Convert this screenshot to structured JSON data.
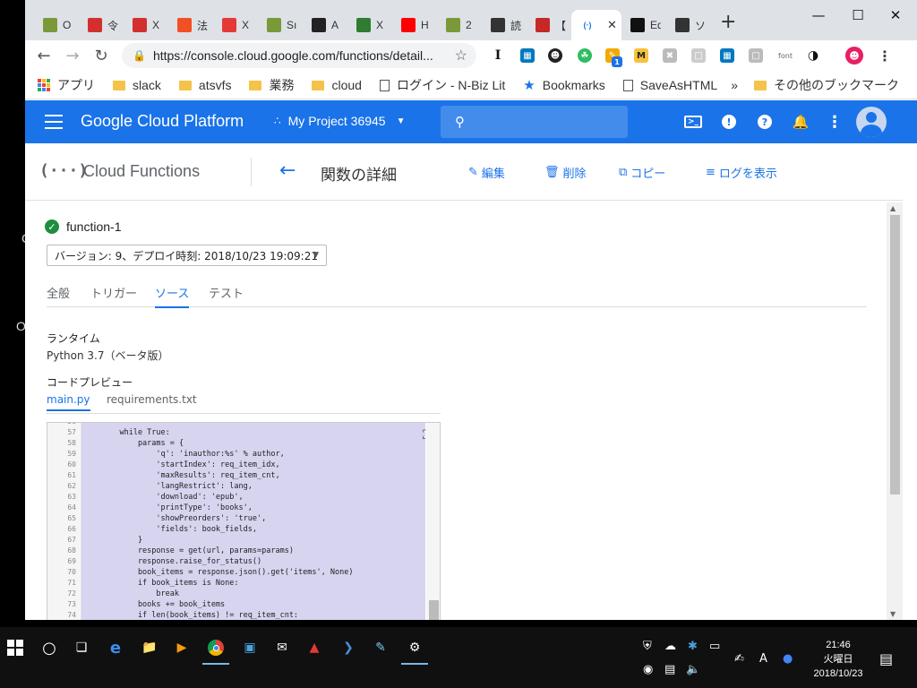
{
  "browser": {
    "tabs": [
      {
        "icon": "window-icon",
        "title": "O",
        "color": "#7a9a3a"
      },
      {
        "icon": "t-logo-icon",
        "title": "令",
        "color": "#d32f2f"
      },
      {
        "icon": "t-logo-icon",
        "title": "X",
        "color": "#d32f2f"
      },
      {
        "icon": "microsoft-icon",
        "title": "法",
        "color": "#f25022"
      },
      {
        "icon": "circle-logo-icon",
        "title": "X",
        "color": "#e53935"
      },
      {
        "icon": "window-icon",
        "title": "Sı",
        "color": "#7a9a3a"
      },
      {
        "icon": "amazon-icon",
        "title": "A",
        "color": "#222222"
      },
      {
        "icon": "leaf-icon",
        "title": "X",
        "color": "#2e7d32"
      },
      {
        "icon": "youtube-icon",
        "title": "H",
        "color": "#ff0000"
      },
      {
        "icon": "window-icon",
        "title": "2",
        "color": "#7a9a3a"
      },
      {
        "icon": "board-icon",
        "title": "読",
        "color": "#333333"
      },
      {
        "icon": "swirl-icon",
        "title": "【",
        "color": "#c62828"
      },
      {
        "icon": "cloud-functions-icon",
        "title": "",
        "color": "#1a73e8",
        "active": true
      },
      {
        "icon": "github-icon",
        "title": "Ed",
        "color": "#111111"
      },
      {
        "icon": "board-icon",
        "title": "ソ",
        "color": "#333333"
      }
    ],
    "url": "https://console.cloud.google.com/functions/detail...",
    "bookmarks": [
      {
        "type": "apps",
        "label": "アプリ"
      },
      {
        "type": "folder",
        "label": "slack"
      },
      {
        "type": "folder",
        "label": "atsvfs"
      },
      {
        "type": "folder",
        "label": "業務"
      },
      {
        "type": "folder",
        "label": "cloud"
      },
      {
        "type": "page",
        "label": "ログイン - N-Biz Lit"
      },
      {
        "type": "star",
        "label": "Bookmarks"
      },
      {
        "type": "page",
        "label": "SaveAsHTML"
      }
    ],
    "bookmarks_more": "»",
    "bookmarks_other": "その他のブックマーク",
    "extension_font_label": "font",
    "extension_badge": "1"
  },
  "gcp": {
    "title": "Google Cloud Platform",
    "project": "My Project 36945"
  },
  "subheader": {
    "product": "Cloud Functions",
    "page_title": "関数の詳細",
    "actions": {
      "edit": "編集",
      "delete": "削除",
      "copy": "コピー",
      "logs": "ログを表示"
    }
  },
  "function": {
    "name": "function-1",
    "version": "バージョン: 9、デプロイ時刻: 2018/10/23 19:09:21",
    "tabs": [
      "全般",
      "トリガー",
      "ソース",
      "テスト"
    ],
    "active_tab": "ソース",
    "runtime_label": "ランタイム",
    "runtime_value": "Python 3.7（ベータ版）",
    "preview_label": "コードプレビュー",
    "files": [
      "main.py",
      "requirements.txt"
    ],
    "active_file": "main.py"
  },
  "code": {
    "lines": [
      {
        "n": "56",
        "text": ""
      },
      {
        "n": "57",
        "text": "    while True:"
      },
      {
        "n": "58",
        "text": "        params = {"
      },
      {
        "n": "59",
        "text": "            'q': 'inauthor:%s' % author,"
      },
      {
        "n": "60",
        "text": "            'startIndex': req_item_idx,"
      },
      {
        "n": "61",
        "text": "            'maxResults': req_item_cnt,"
      },
      {
        "n": "62",
        "text": "            'langRestrict': lang,"
      },
      {
        "n": "63",
        "text": "            'download': 'epub',"
      },
      {
        "n": "64",
        "text": "            'printType': 'books',"
      },
      {
        "n": "65",
        "text": "            'showPreorders': 'true',"
      },
      {
        "n": "66",
        "text": "            'fields': book_fields,"
      },
      {
        "n": "67",
        "text": "        }"
      },
      {
        "n": "68",
        "text": "        response = get(url, params=params)"
      },
      {
        "n": "69",
        "text": "        response.raise_for_status()"
      },
      {
        "n": "70",
        "text": "        book_items = response.json().get('items', None)"
      },
      {
        "n": "71",
        "text": "        if book_items is None:"
      },
      {
        "n": "72",
        "text": "            break"
      },
      {
        "n": "73",
        "text": "        books += book_items"
      },
      {
        "n": "74",
        "text": "        if len(book_items) != req_item_cnt:"
      }
    ]
  },
  "taskbar": {
    "time": "21:46",
    "day": "火曜日",
    "date": "2018/10/23",
    "ime": "A"
  },
  "colors": {
    "gcp_blue": "#1a73e8",
    "success_green": "#1e8e3e",
    "code_highlight": "#d7d4f0"
  }
}
